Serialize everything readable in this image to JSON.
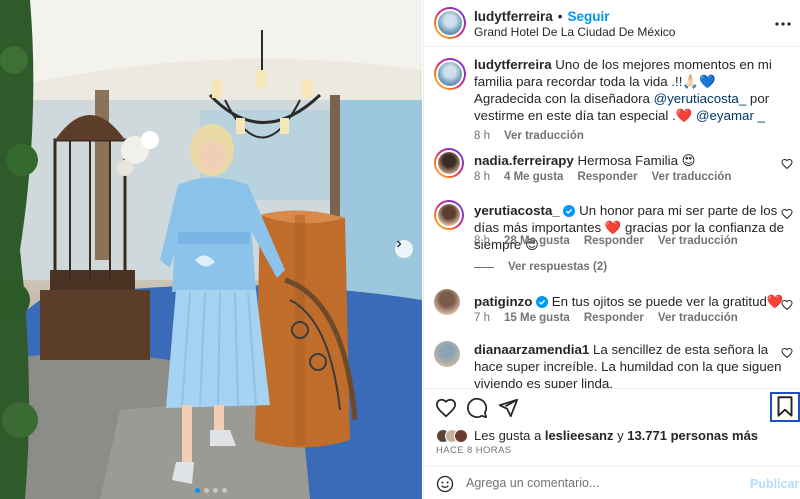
{
  "post": {
    "username": "ludytferreira",
    "separator": "•",
    "follow_label": "Seguir",
    "location": "Grand Hotel De La Ciudad De México",
    "more_icon": "more-horizontal-icon",
    "carousel": {
      "total_slides": 4,
      "active_slide": 1,
      "next_icon": "chevron-right-icon"
    }
  },
  "caption": {
    "username": "ludytferreira",
    "text_1": "Uno de los mejores momentos en mi familia para recordar toda la vida .!!🙏🏻💙",
    "text_2": "Agradecida con la diseñadora ",
    "mention_1": "@yerutiacosta_",
    "text_3": " por vestirme en este día tan especial .❤️ ",
    "mention_2": "@eyamar _",
    "time": "8 h",
    "translate": "Ver traducción"
  },
  "comments": [
    {
      "username": "nadia.ferreirapy",
      "text": "Hermosa Familia 😍",
      "time": "8 h",
      "likes": "4 Me gusta",
      "reply": "Responder",
      "translate": "Ver traducción"
    },
    {
      "username": "yerutiacosta_",
      "verified": true,
      "text": "Un honor para mi ser parte de los días más importantes ❤️ gracias por la confianza de siempre 😍",
      "time": "8 h",
      "likes": "28 Me gusta",
      "reply": "Responder",
      "translate": "Ver traducción",
      "view_replies": "Ver respuestas (2)"
    },
    {
      "username": "patiginzo",
      "verified": true,
      "text": "En tus ojitos se puede ver la gratitud❤️",
      "time": "7 h",
      "likes": "15 Me gusta",
      "reply": "Responder",
      "translate": "Ver traducción"
    },
    {
      "username": "dianaarzamendia1",
      "text": "La sencillez de esta señora la hace super increíble. La humildad con la que siguen viviendo es super linda."
    }
  ],
  "actions": {
    "like_icon": "heart-icon",
    "comment_icon": "comment-icon",
    "share_icon": "send-icon",
    "save_icon": "bookmark-icon"
  },
  "likes": {
    "prefix": "Les gusta a ",
    "user": "leslieesanz",
    "middle": " y ",
    "count": "13.771 personas más"
  },
  "date": "HACE 8 HORAS",
  "comment_box": {
    "emoji_icon": "smiley-icon",
    "placeholder": "Agrega un comentario...",
    "publish_label": "Publicar"
  },
  "colors": {
    "link": "#0095f6",
    "mention": "#00376b",
    "muted": "#737373",
    "publish_disabled": "#b2dffc",
    "like_red": "#ed4956"
  }
}
